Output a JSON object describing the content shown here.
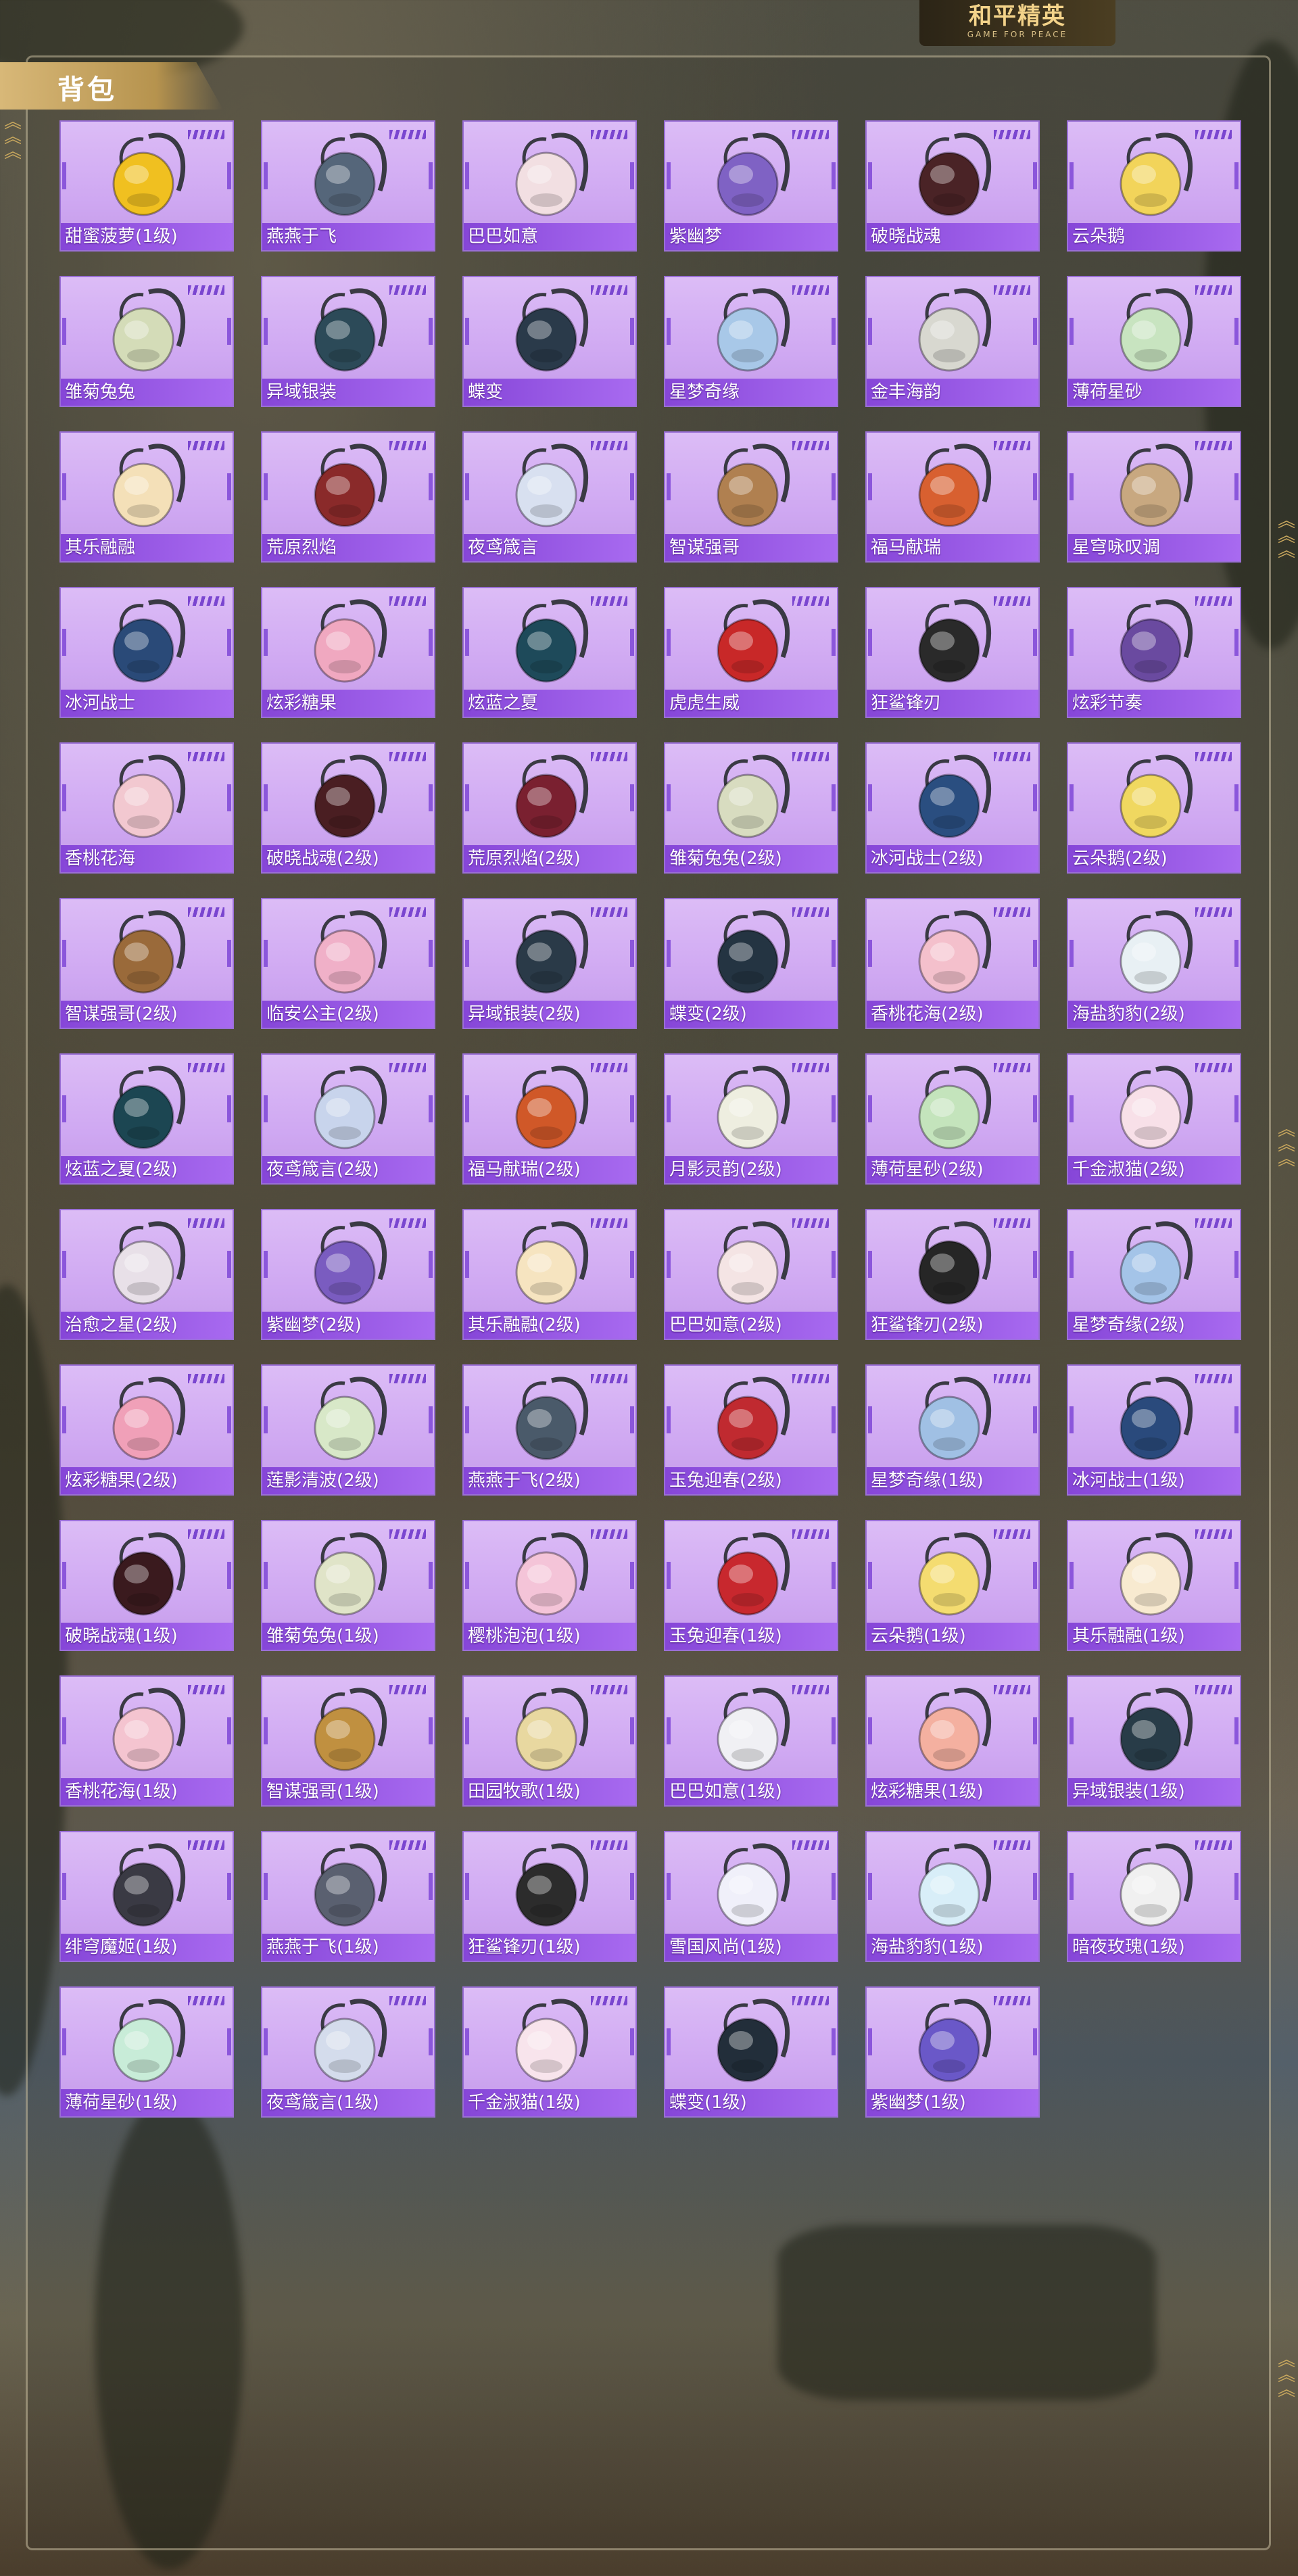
{
  "header": {
    "logo_main": "和平精英",
    "logo_sub": "GAME FOR PEACE"
  },
  "page": {
    "title": "背包"
  },
  "colors": {
    "card_bg": "#d6b3f4",
    "card_bar": "#9556e0",
    "title_tab": "#c9a665"
  },
  "items": [
    {
      "label": "甜蜜菠萝(1级)",
      "icon": "pineapple-backpack-icon",
      "c": "#f0c020"
    },
    {
      "label": "燕燕于飞",
      "icon": "swallow-backpack-icon",
      "c": "#55667a"
    },
    {
      "label": "巴巴如意",
      "icon": "cat-backpack-icon",
      "c": "#f2dfe2"
    },
    {
      "label": "紫幽梦",
      "icon": "purple-dream-backpack-icon",
      "c": "#7f62c4"
    },
    {
      "label": "破晓战魂",
      "icon": "dawn-warrior-backpack-icon",
      "c": "#4a2326"
    },
    {
      "label": "云朵鹅",
      "icon": "cloud-goose-backpack-icon",
      "c": "#f2d45a"
    },
    {
      "label": "雏菊兔兔",
      "icon": "daisy-bunny-backpack-icon",
      "c": "#d4dcb8"
    },
    {
      "label": "异域银装",
      "icon": "exotic-silver-backpack-icon",
      "c": "#2c4a58"
    },
    {
      "label": "蝶变",
      "icon": "butterfly-backpack-icon",
      "c": "#2a3a4a"
    },
    {
      "label": "星梦奇缘",
      "icon": "swan-backpack-icon",
      "c": "#a8c8e8"
    },
    {
      "label": "金丰海韵",
      "icon": "golden-sea-backpack-icon",
      "c": "#d8d8d0"
    },
    {
      "label": "薄荷星砂",
      "icon": "mint-backpack-icon",
      "c": "#c8e4c0"
    },
    {
      "label": "其乐融融",
      "icon": "cupcake-backpack-icon",
      "c": "#f4e0b8"
    },
    {
      "label": "荒原烈焰",
      "icon": "wasteland-flame-backpack-icon",
      "c": "#8a2a2a"
    },
    {
      "label": "夜鸢箴言",
      "icon": "night-kite-backpack-icon",
      "c": "#d8e0f0"
    },
    {
      "label": "智谋强哥",
      "icon": "bear-backpack-icon",
      "c": "#b08050"
    },
    {
      "label": "福马献瑞",
      "icon": "horse-backpack-icon",
      "c": "#d86030"
    },
    {
      "label": "星穹咏叹调",
      "icon": "aria-backpack-icon",
      "c": "#c8a880"
    },
    {
      "label": "冰河战士",
      "icon": "glacier-warrior-backpack-icon",
      "c": "#2a4a78"
    },
    {
      "label": "炫彩糖果",
      "icon": "candy-backpack-icon",
      "c": "#f0a8c0"
    },
    {
      "label": "炫蓝之夏",
      "icon": "blue-summer-backpack-icon",
      "c": "#1e4a5a"
    },
    {
      "label": "虎虎生威",
      "icon": "tiger-backpack-icon",
      "c": "#c82828"
    },
    {
      "label": "狂鲨锋刃",
      "icon": "shark-backpack-icon",
      "c": "#2a2a2a"
    },
    {
      "label": "炫彩节奏",
      "icon": "rhythm-backpack-icon",
      "c": "#6a4aa0"
    },
    {
      "label": "香桃花海",
      "icon": "peach-blossom-backpack-icon",
      "c": "#f2c8d0"
    },
    {
      "label": "破晓战魂(2级)",
      "icon": "dawn-warrior-backpack-icon",
      "c": "#4a1e22"
    },
    {
      "label": "荒原烈焰(2级)",
      "icon": "wasteland-flame-backpack-icon",
      "c": "#7a2030"
    },
    {
      "label": "雏菊兔兔(2级)",
      "icon": "daisy-bunny-backpack-icon",
      "c": "#d8dcc0"
    },
    {
      "label": "冰河战士(2级)",
      "icon": "glacier-warrior-backpack-icon",
      "c": "#2a4e80"
    },
    {
      "label": "云朵鹅(2级)",
      "icon": "cloud-goose-backpack-icon",
      "c": "#f0d860"
    },
    {
      "label": "智谋强哥(2级)",
      "icon": "bear-backpack-icon",
      "c": "#9a6a3a"
    },
    {
      "label": "临安公主(2级)",
      "icon": "princess-backpack-icon",
      "c": "#f0b0c8"
    },
    {
      "label": "异域银装(2级)",
      "icon": "exotic-silver-backpack-icon",
      "c": "#2a3a48"
    },
    {
      "label": "蝶变(2级)",
      "icon": "butterfly-backpack-icon",
      "c": "#243442"
    },
    {
      "label": "香桃花海(2级)",
      "icon": "peach-blossom-backpack-icon",
      "c": "#f4c0cc"
    },
    {
      "label": "海盐豹豹(2级)",
      "icon": "leopard-backpack-icon",
      "c": "#e8f0f4"
    },
    {
      "label": "炫蓝之夏(2级)",
      "icon": "blue-summer-backpack-icon",
      "c": "#1c4652"
    },
    {
      "label": "夜鸢箴言(2级)",
      "icon": "night-kite-backpack-icon",
      "c": "#c8d4ec"
    },
    {
      "label": "福马献瑞(2级)",
      "icon": "horse-backpack-icon",
      "c": "#d05828"
    },
    {
      "label": "月影灵韵(2级)",
      "icon": "moon-shadow-backpack-icon",
      "c": "#eeeee0"
    },
    {
      "label": "薄荷星砂(2级)",
      "icon": "mint-backpack-icon",
      "c": "#c4e4bc"
    },
    {
      "label": "千金淑猫(2级)",
      "icon": "lady-cat-backpack-icon",
      "c": "#f8e0e8"
    },
    {
      "label": "治愈之星(2级)",
      "icon": "healing-star-backpack-icon",
      "c": "#e8e0e8"
    },
    {
      "label": "紫幽梦(2级)",
      "icon": "purple-dream-backpack-icon",
      "c": "#7a5cc0"
    },
    {
      "label": "其乐融融(2级)",
      "icon": "cupcake-backpack-icon",
      "c": "#f6e4c0"
    },
    {
      "label": "巴巴如意(2级)",
      "icon": "cat-backpack-icon",
      "c": "#f4e4e4"
    },
    {
      "label": "狂鲨锋刃(2级)",
      "icon": "shark-backpack-icon",
      "c": "#262626"
    },
    {
      "label": "星梦奇缘(2级)",
      "icon": "swan-backpack-icon",
      "c": "#a4c4e8"
    },
    {
      "label": "炫彩糖果(2级)",
      "icon": "candy-backpack-icon",
      "c": "#f0a0b8"
    },
    {
      "label": "莲影清波(2级)",
      "icon": "lotus-backpack-icon",
      "c": "#d8e8c8"
    },
    {
      "label": "燕燕于飞(2级)",
      "icon": "swallow-backpack-icon",
      "c": "#4a5a6a"
    },
    {
      "label": "玉兔迎春(2级)",
      "icon": "jade-rabbit-backpack-icon",
      "c": "#c02a30"
    },
    {
      "label": "星梦奇缘(1级)",
      "icon": "swan-backpack-icon",
      "c": "#a0c0e4"
    },
    {
      "label": "冰河战士(1级)",
      "icon": "glacier-warrior-backpack-icon",
      "c": "#2a4a7c"
    },
    {
      "label": "破晓战魂(1级)",
      "icon": "dawn-warrior-backpack-icon",
      "c": "#3a1a1e"
    },
    {
      "label": "雏菊兔兔(1级)",
      "icon": "daisy-bunny-backpack-icon",
      "c": "#e0e4c8"
    },
    {
      "label": "樱桃泡泡(1级)",
      "icon": "cherry-bubble-backpack-icon",
      "c": "#f4c4d8"
    },
    {
      "label": "玉兔迎春(1级)",
      "icon": "jade-rabbit-backpack-icon",
      "c": "#c8282e"
    },
    {
      "label": "云朵鹅(1级)",
      "icon": "cloud-goose-backpack-icon",
      "c": "#f4dc70"
    },
    {
      "label": "其乐融融(1级)",
      "icon": "cupcake-backpack-icon",
      "c": "#f8ead0"
    },
    {
      "label": "香桃花海(1级)",
      "icon": "peach-blossom-backpack-icon",
      "c": "#f4c4d0"
    },
    {
      "label": "智谋强哥(1级)",
      "icon": "bear-backpack-icon",
      "c": "#c09040"
    },
    {
      "label": "田园牧歌(1级)",
      "icon": "pastoral-basket-backpack-icon",
      "c": "#e8d8a0"
    },
    {
      "label": "巴巴如意(1级)",
      "icon": "cat-backpack-icon",
      "c": "#f0f0f4"
    },
    {
      "label": "炫彩糖果(1级)",
      "icon": "candy-backpack-icon",
      "c": "#f4b0a0"
    },
    {
      "label": "异域银装(1级)",
      "icon": "exotic-silver-backpack-icon",
      "c": "#283c48"
    },
    {
      "label": "绯穹魔姬(1级)",
      "icon": "crimson-witch-backpack-icon",
      "c": "#3a3a44"
    },
    {
      "label": "燕燕于飞(1级)",
      "icon": "swallow-backpack-icon",
      "c": "#5a6070"
    },
    {
      "label": "狂鲨锋刃(1级)",
      "icon": "shark-backpack-icon",
      "c": "#2c2c2c"
    },
    {
      "label": "雪国风尚(1级)",
      "icon": "snow-fashion-backpack-icon",
      "c": "#f0f0fa"
    },
    {
      "label": "海盐豹豹(1级)",
      "icon": "leopard-backpack-icon",
      "c": "#d8eef8"
    },
    {
      "label": "暗夜玫瑰(1级)",
      "icon": "dark-rose-backpack-icon",
      "c": "#f0f0f0"
    },
    {
      "label": "薄荷星砂(1级)",
      "icon": "mint-backpack-icon",
      "c": "#c8ecd8"
    },
    {
      "label": "夜鸢箴言(1级)",
      "icon": "night-kite-backpack-icon",
      "c": "#d4dcec"
    },
    {
      "label": "千金淑猫(1级)",
      "icon": "lady-cat-backpack-icon",
      "c": "#f8e4ec"
    },
    {
      "label": "蝶变(1级)",
      "icon": "butterfly-backpack-icon",
      "c": "#222e3a"
    },
    {
      "label": "紫幽梦(1级)",
      "icon": "purple-dream-backpack-icon",
      "c": "#6a58c8"
    }
  ]
}
